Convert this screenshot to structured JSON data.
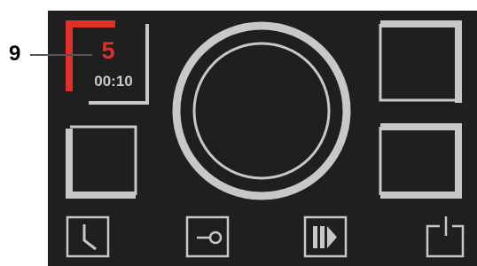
{
  "callout": {
    "label": "9"
  },
  "zones": {
    "front_left": {
      "power_level": "5",
      "timer": "00:10",
      "active": true
    }
  },
  "colors": {
    "panel_background": "#1f1f1f",
    "outline": "#c8c8c8",
    "active_accent": "#e0302a",
    "callout_text": "#000000"
  },
  "icons": {
    "timer_button": "clock-icon",
    "lock_button": "key-icon",
    "boost_button": "boost-icon",
    "power_button": "power-icon"
  }
}
